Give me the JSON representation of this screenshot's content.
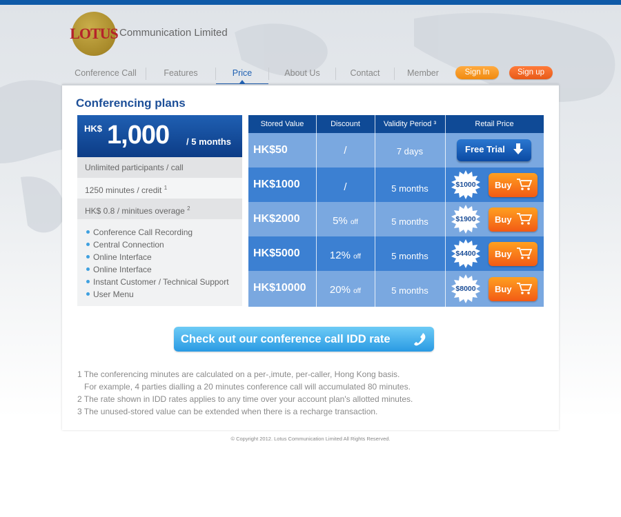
{
  "colors": {
    "brand_blue": "#1d4f98",
    "nav_active": "#2061b3",
    "signin": "#f5951e",
    "signup": "#ee6a24",
    "table_head": "#0f4a96",
    "row_light": "#7aa8e0",
    "row_dark": "#3c80d2",
    "logo_gold": "#a88a2a",
    "logo_red": "#b5232a"
  },
  "header": {
    "logo_text": "LOTUS",
    "company": "Communication Limited"
  },
  "nav": {
    "items": [
      {
        "label": "Conference Call"
      },
      {
        "label": "Features"
      },
      {
        "label": "Price",
        "active": true
      },
      {
        "label": "About Us"
      },
      {
        "label": "Contact"
      },
      {
        "label": "Member"
      }
    ],
    "signin": "Sign In",
    "signup": "Sign up"
  },
  "page": {
    "title": "Conferencing plans"
  },
  "plan": {
    "currency": "HK$",
    "amount": "1,000",
    "period": "/ 5 months",
    "rows": [
      {
        "text": "Unlimited participants / call",
        "sup": ""
      },
      {
        "text": "1250 minutes / credit",
        "sup": "1"
      },
      {
        "text": "HK$ 0.8 / minitues overage",
        "sup": "2"
      }
    ],
    "features": [
      "Conference Call Recording",
      "Central Connection",
      "Online Interface",
      "Online Interface",
      "Instant Customer / Technical Support",
      "User Menu"
    ]
  },
  "table": {
    "headers": [
      "Stored Value",
      "Discount",
      "Validity Period ³",
      "Retail Price"
    ],
    "rows": [
      {
        "stored": "HK$50",
        "discount": "/",
        "discount_suffix": "",
        "validity": "7 days",
        "action": "Free Trial",
        "price": ""
      },
      {
        "stored": "HK$1000",
        "discount": "/",
        "discount_suffix": "",
        "validity": "5 months",
        "action": "Buy",
        "price": "$1000"
      },
      {
        "stored": "HK$2000",
        "discount": "5%",
        "discount_suffix": "off",
        "validity": "5 months",
        "action": "Buy",
        "price": "$1900"
      },
      {
        "stored": "HK$5000",
        "discount": "12%",
        "discount_suffix": "off",
        "validity": "5 months",
        "action": "Buy",
        "price": "$4400"
      },
      {
        "stored": "HK$10000",
        "discount": "20%",
        "discount_suffix": "off",
        "validity": "5 months",
        "action": "Buy",
        "price": "$8000"
      }
    ]
  },
  "idd_button": "Check out our conference call IDD rate",
  "notes": [
    "1 The conferencing minutes are calculated on a per-,imute, per-caller, Hong Kong basis.",
    "   For example, 4 parties dialling a 20 minutes conference call will accumulated 80 minutes.",
    "2 The rate shown in IDD rates applies to any time over your account plan's allotted minutes.",
    "3 The unused-stored value can be extended when there is a recharge transaction."
  ],
  "footer": {
    "copyright": "© Copyright 2012. Lotus Communication Limited All Rights Reserved."
  },
  "icons": {
    "free_trial": "arrow-down-icon",
    "buy": "cart-icon",
    "idd": "phone-icon"
  }
}
